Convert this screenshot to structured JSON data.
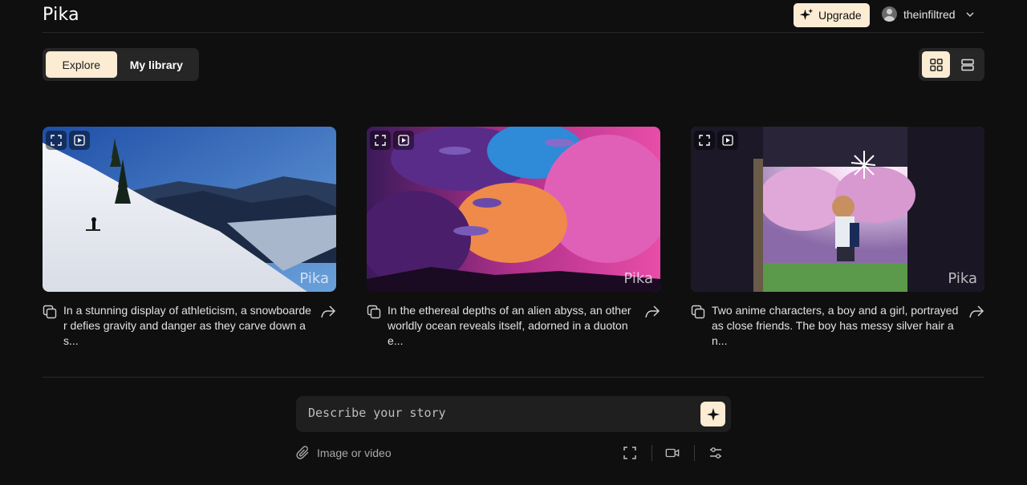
{
  "header": {
    "logo": "Pika",
    "upgrade_label": "Upgrade",
    "username": "theinfiltred"
  },
  "tabs": [
    {
      "label": "Explore",
      "active": true
    },
    {
      "label": "My library",
      "active": false
    }
  ],
  "view_toggle": [
    {
      "icon": "grid-view-icon",
      "active": true
    },
    {
      "icon": "list-view-icon",
      "active": false
    }
  ],
  "cards": [
    {
      "scene": "snowboarder on mountain slope",
      "watermark": "Pika",
      "caption": "In a stunning display of athleticism, a snowboarder defies gravity and danger as they carve down a s..."
    },
    {
      "scene": "alien ocean with pink clouds",
      "watermark": "Pika",
      "caption": "In the ethereal depths of an alien abyss, an otherworldly ocean reveals itself, adorned in a duotone..."
    },
    {
      "scene": "anime girl under cherry blossoms",
      "watermark": "Pika",
      "caption": "Two anime characters, a boy and a girl, portrayed as close friends. The boy has messy silver hair an..."
    }
  ],
  "prompt": {
    "placeholder": "Describe your story",
    "attach_label": "Image or video"
  },
  "colors": {
    "background": "#0f0f0f",
    "accent": "#fbecd3",
    "surface": "#262626"
  }
}
